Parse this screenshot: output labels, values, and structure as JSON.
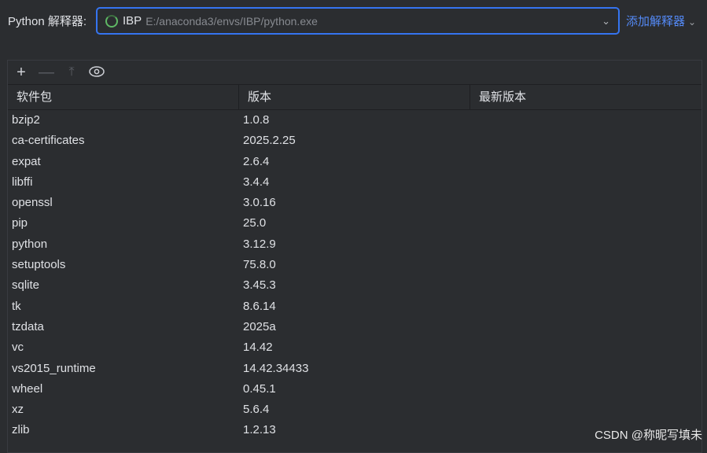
{
  "interpreter": {
    "label": "Python 解释器:",
    "env_name": "IBP",
    "env_path": "E:/anaconda3/envs/IBP/python.exe",
    "add_label": "添加解释器"
  },
  "toolbar": {
    "icons": [
      "plus-icon",
      "minus-icon",
      "upgrade-icon",
      "eye-icon"
    ]
  },
  "table": {
    "columns": [
      "软件包",
      "版本",
      "最新版本"
    ],
    "rows": [
      [
        "bzip2",
        "1.0.8",
        ""
      ],
      [
        "ca-certificates",
        "2025.2.25",
        ""
      ],
      [
        "expat",
        "2.6.4",
        ""
      ],
      [
        "libffi",
        "3.4.4",
        ""
      ],
      [
        "openssl",
        "3.0.16",
        ""
      ],
      [
        "pip",
        "25.0",
        ""
      ],
      [
        "python",
        "3.12.9",
        ""
      ],
      [
        "setuptools",
        "75.8.0",
        ""
      ],
      [
        "sqlite",
        "3.45.3",
        ""
      ],
      [
        "tk",
        "8.6.14",
        ""
      ],
      [
        "tzdata",
        "2025a",
        ""
      ],
      [
        "vc",
        "14.42",
        ""
      ],
      [
        "vs2015_runtime",
        "14.42.34433",
        ""
      ],
      [
        "wheel",
        "0.45.1",
        ""
      ],
      [
        "xz",
        "5.6.4",
        ""
      ],
      [
        "zlib",
        "1.2.13",
        ""
      ]
    ]
  },
  "watermark": "CSDN @称昵写填未"
}
